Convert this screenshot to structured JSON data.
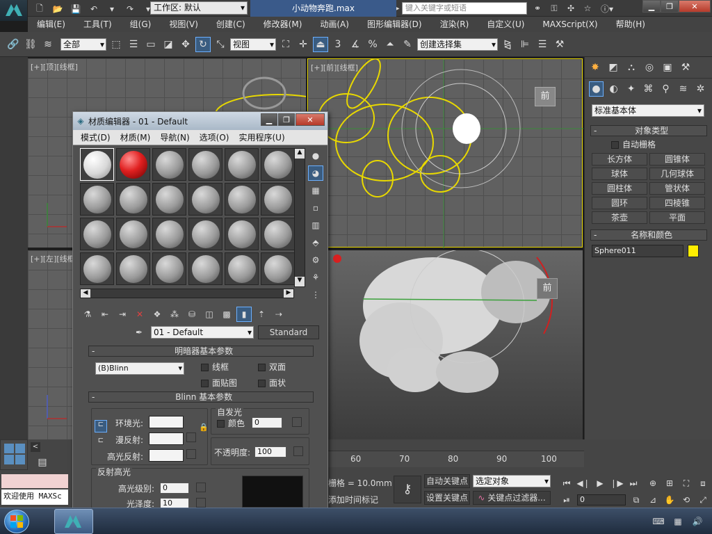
{
  "app": {
    "workspace_label": "工作区: 默认",
    "filename": "小动物奔跑.max",
    "search_placeholder": "键入关键字或短语"
  },
  "menubar": [
    "编辑(E)",
    "工具(T)",
    "组(G)",
    "视图(V)",
    "创建(C)",
    "修改器(M)",
    "动画(A)",
    "图形编辑器(D)",
    "渲染(R)",
    "自定义(U)",
    "MAXScript(X)",
    "帮助(H)"
  ],
  "toolbar": {
    "selection_filter": "全部",
    "ref_coord": "视图",
    "named_selection": "创建选择集",
    "angle_snap": "3",
    "percent_snap": "%"
  },
  "viewports": {
    "top_left": "[+][顶][线框]",
    "front": "[+][前][线框]",
    "left": "[+][左][线框]",
    "front_cube": "前",
    "persp_cube": "前"
  },
  "command_panel": {
    "dropdown": "标准基本体",
    "object_type_header": "对象类型",
    "auto_grid": "自动栅格",
    "buttons": [
      "长方体",
      "圆锥体",
      "球体",
      "几何球体",
      "圆柱体",
      "管状体",
      "圆环",
      "四棱锥",
      "茶壶",
      "平面"
    ],
    "name_color_header": "名称和颜色",
    "object_name": "Sphere011",
    "object_color": "#ffee00"
  },
  "material_editor": {
    "title": "材质编辑器 - 01 - Default",
    "menu": [
      "模式(D)",
      "材质(M)",
      "导航(N)",
      "选项(O)",
      "实用程序(U)"
    ],
    "material_name": "01 - Default",
    "material_type": "Standard",
    "shader_header": "明暗器基本参数",
    "shader": "(B)Blinn",
    "options": [
      "线框",
      "双面",
      "面贴图",
      "面状"
    ],
    "blinn_header": "Blinn 基本参数",
    "self_illum_label": "自发光",
    "self_illum_color_label": "颜色",
    "self_illum_value": "0",
    "ambient_label": "环境光:",
    "diffuse_label": "漫反射:",
    "specular_label": "高光反射:",
    "opacity_label": "不透明度:",
    "opacity_value": "100",
    "spec_highlights_label": "反射高光",
    "spec_level_label": "高光级别:",
    "spec_level_value": "0",
    "glossiness_label": "光泽度:",
    "glossiness_value": "10"
  },
  "timeline": {
    "ticks": [
      "60",
      "70",
      "80",
      "90",
      "100"
    ]
  },
  "bottom": {
    "welcome": "欢迎使用 MAXSc",
    "grid_label": "栅格 = 10.0mm",
    "add_time_tag": "添加时间标记",
    "auto_key": "自动关键点",
    "set_key": "设置关键点",
    "selected": "选定对象",
    "key_filters": "关键点过滤器...",
    "frame": "0"
  }
}
